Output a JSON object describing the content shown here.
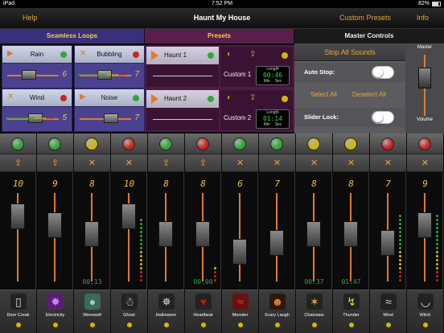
{
  "status_bar": {
    "carrier": "iPad",
    "time": "7:52 PM",
    "battery": "82%",
    "battery_level": 0.82
  },
  "nav": {
    "left_button": "Help",
    "title": "Haunt My House",
    "custom_presets": "Custom Presets",
    "info": "Info"
  },
  "loops": {
    "header": "Seamless Loops",
    "items": [
      {
        "name": "Rain",
        "icon": "play-icon",
        "led": "#2ea838",
        "value": "6"
      },
      {
        "name": "Bubbling",
        "icon": "stop-x-icon",
        "led": "#cc2222",
        "value": "7"
      },
      {
        "name": "Wind",
        "icon": "stop-x-icon",
        "led": "#cc2222",
        "value": "5"
      },
      {
        "name": "Noise",
        "icon": "play-icon",
        "led": "#2ea838",
        "value": "7"
      }
    ]
  },
  "presets": {
    "header": "Presets",
    "items": [
      {
        "name": "Haunt 1",
        "led": "#2ea838",
        "custom": "Custom 1",
        "length": "00:46",
        "custom_led": "#d4b800"
      },
      {
        "name": "Haunt 2",
        "led": "#2ea838",
        "custom": "Custom 2",
        "length": "01:14",
        "custom_led": "#d4b800"
      }
    ],
    "length_label": "Length",
    "min_label": "Min",
    "sec_label": "Sec"
  },
  "master": {
    "header": "Master Controls",
    "stop_all": "Stop All Sounds",
    "auto_stop": "Auto Stop:",
    "select_all": "Select All",
    "deselect_all": "Deselect All",
    "slider_lock": "Slider Lock:",
    "master_label": "Master",
    "volume_label": "Volume"
  },
  "channels": [
    {
      "name": "Door Creak",
      "led": "#2ea838",
      "action": "share",
      "volume": "10",
      "time": "",
      "icon": "door-icon",
      "knob": 0.12,
      "meter": 0
    },
    {
      "name": "Electricity",
      "led": "#2ea838",
      "action": "share",
      "volume": "9",
      "time": "",
      "icon": "plasma-icon",
      "knob": 0.22,
      "meter": 0
    },
    {
      "name": "Werewolf",
      "led": "#d4b800",
      "action": "x",
      "volume": "8",
      "time": "00:13",
      "icon": "moon-icon",
      "knob": 0.32,
      "meter": 0
    },
    {
      "name": "Ghost",
      "led": "#cc2222",
      "action": "x",
      "volume": "10",
      "time": "",
      "icon": "ghost-icon",
      "knob": 0.12,
      "meter": 16
    },
    {
      "name": "Halloween",
      "led": "#2ea838",
      "action": "share",
      "volume": "8",
      "time": "",
      "icon": "web-icon",
      "knob": 0.32,
      "meter": 0
    },
    {
      "name": "Heartbeat",
      "led": "#cc2222",
      "action": "share",
      "volume": "8",
      "time": "00:00",
      "icon": "heart-icon",
      "knob": 0.32,
      "meter": 4
    },
    {
      "name": "Monster",
      "led": "#2ea838",
      "action": "x",
      "volume": "6",
      "time": "",
      "icon": "claw-icon",
      "knob": 0.52,
      "meter": 0
    },
    {
      "name": "Scary Laugh",
      "led": "#2ea838",
      "action": "x",
      "volume": "7",
      "time": "",
      "icon": "pumpkin-icon",
      "knob": 0.42,
      "meter": 0
    },
    {
      "name": "Chainsaw",
      "led": "#d4b800",
      "action": "x",
      "volume": "8",
      "time": "00:37",
      "icon": "zap-icon",
      "knob": 0.32,
      "meter": 0
    },
    {
      "name": "Thunder",
      "led": "#d4b800",
      "action": "x",
      "volume": "8",
      "time": "01:47",
      "icon": "bolt-icon",
      "knob": 0.32,
      "meter": 0
    },
    {
      "name": "Wind",
      "led": "#cc2222",
      "action": "x",
      "volume": "7",
      "time": "",
      "icon": "wind-icon",
      "knob": 0.42,
      "meter": 17
    },
    {
      "name": "Witch",
      "led": "#cc2222",
      "action": "x",
      "volume": "9",
      "time": "",
      "icon": "cauldron-icon",
      "knob": 0.22,
      "meter": 17
    }
  ]
}
